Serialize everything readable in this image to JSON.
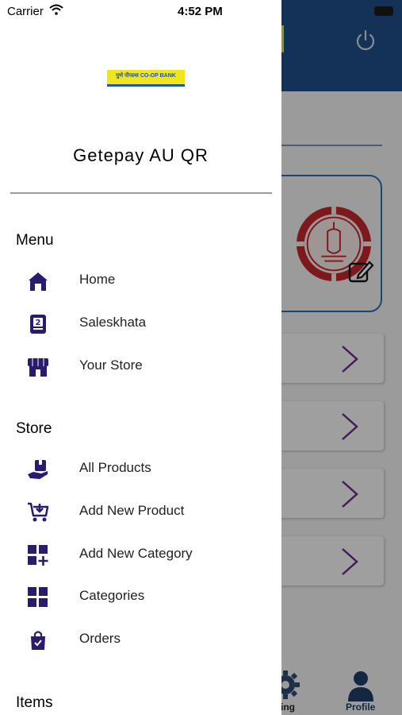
{
  "status_bar": {
    "carrier": "Carrier",
    "time": "4:52 PM"
  },
  "header": {
    "bank_logo_text": "पुणे पीपल्स CO-OP BANK",
    "title": "Getepay AU QR"
  },
  "menu": {
    "title": "Menu",
    "items": [
      {
        "label": "Home",
        "icon": "home-icon"
      },
      {
        "label": "Saleskhata",
        "icon": "saleskhata-icon"
      },
      {
        "label": "Your Store",
        "icon": "store-icon"
      }
    ]
  },
  "store": {
    "title": "Store",
    "items": [
      {
        "label": "All Products",
        "icon": "products-hand-icon"
      },
      {
        "label": "Add New Product",
        "icon": "cart-add-icon"
      },
      {
        "label": "Add New Category",
        "icon": "grid-add-icon"
      },
      {
        "label": "Categories",
        "icon": "grid-icon"
      },
      {
        "label": "Orders",
        "icon": "shopping-bag-icon"
      }
    ]
  },
  "items_section": {
    "title": "Items"
  },
  "background_tabbar": {
    "settings_label": "ting",
    "profile_label": "Profile"
  },
  "colors": {
    "icon": "#2b1a6e",
    "app_blue": "#1f4e86",
    "logo_yellow": "#f1e51c",
    "chevron": "#6a2a8a"
  }
}
